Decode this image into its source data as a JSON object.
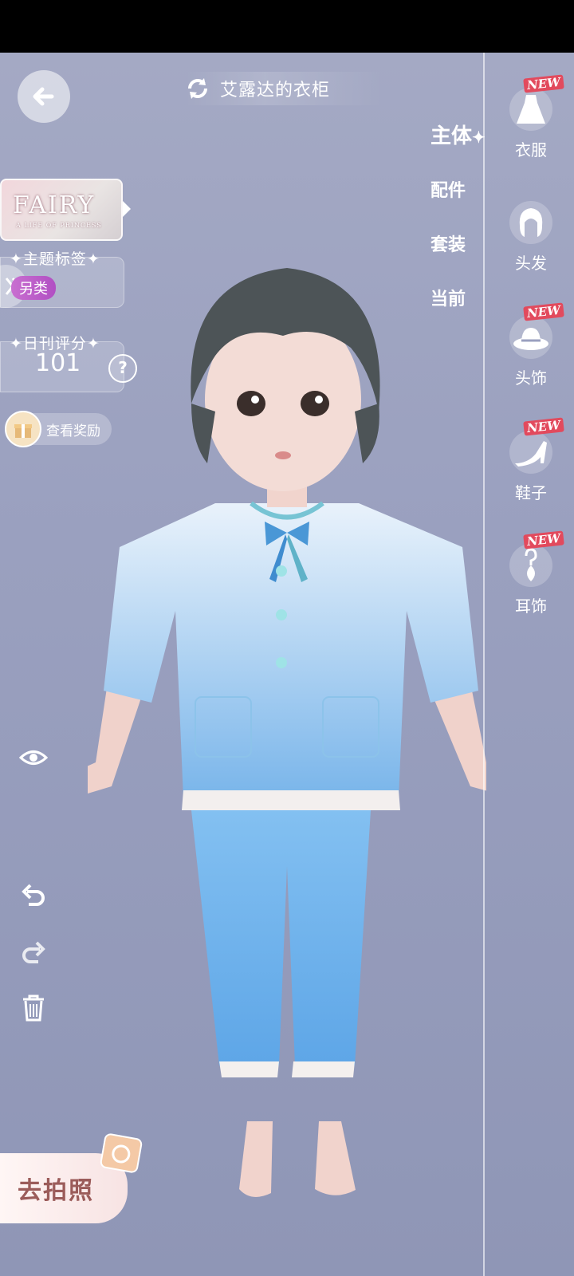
{
  "header": {
    "title": "艾露达的衣柜"
  },
  "theme_card": {
    "logo": "FAIRY",
    "subtitle": "A LIFE OF PRINCESS"
  },
  "theme_tag": {
    "label": "主题标签",
    "value": "另类"
  },
  "daily_score": {
    "label": "日刊评分",
    "value": "101",
    "help": "?"
  },
  "reward": {
    "label": "查看奖励"
  },
  "category_tabs": [
    {
      "label": "主体",
      "active": true
    },
    {
      "label": "配件",
      "active": false
    },
    {
      "label": "套装",
      "active": false
    },
    {
      "label": "当前",
      "active": false
    }
  ],
  "right_items": [
    {
      "label": "衣服",
      "icon": "dress-icon",
      "badge": "NEW"
    },
    {
      "label": "头发",
      "icon": "hair-icon",
      "badge": ""
    },
    {
      "label": "头饰",
      "icon": "hat-icon",
      "badge": "NEW"
    },
    {
      "label": "鞋子",
      "icon": "shoe-icon",
      "badge": "NEW"
    },
    {
      "label": "耳饰",
      "icon": "earring-icon",
      "badge": "NEW"
    }
  ],
  "photo_button": {
    "label": "去拍照"
  },
  "colors": {
    "background": "#9aa0bf",
    "tag_pill": "#b14fc3",
    "new_badge": "#e24a5d",
    "pajama": "#7fb7ea"
  }
}
